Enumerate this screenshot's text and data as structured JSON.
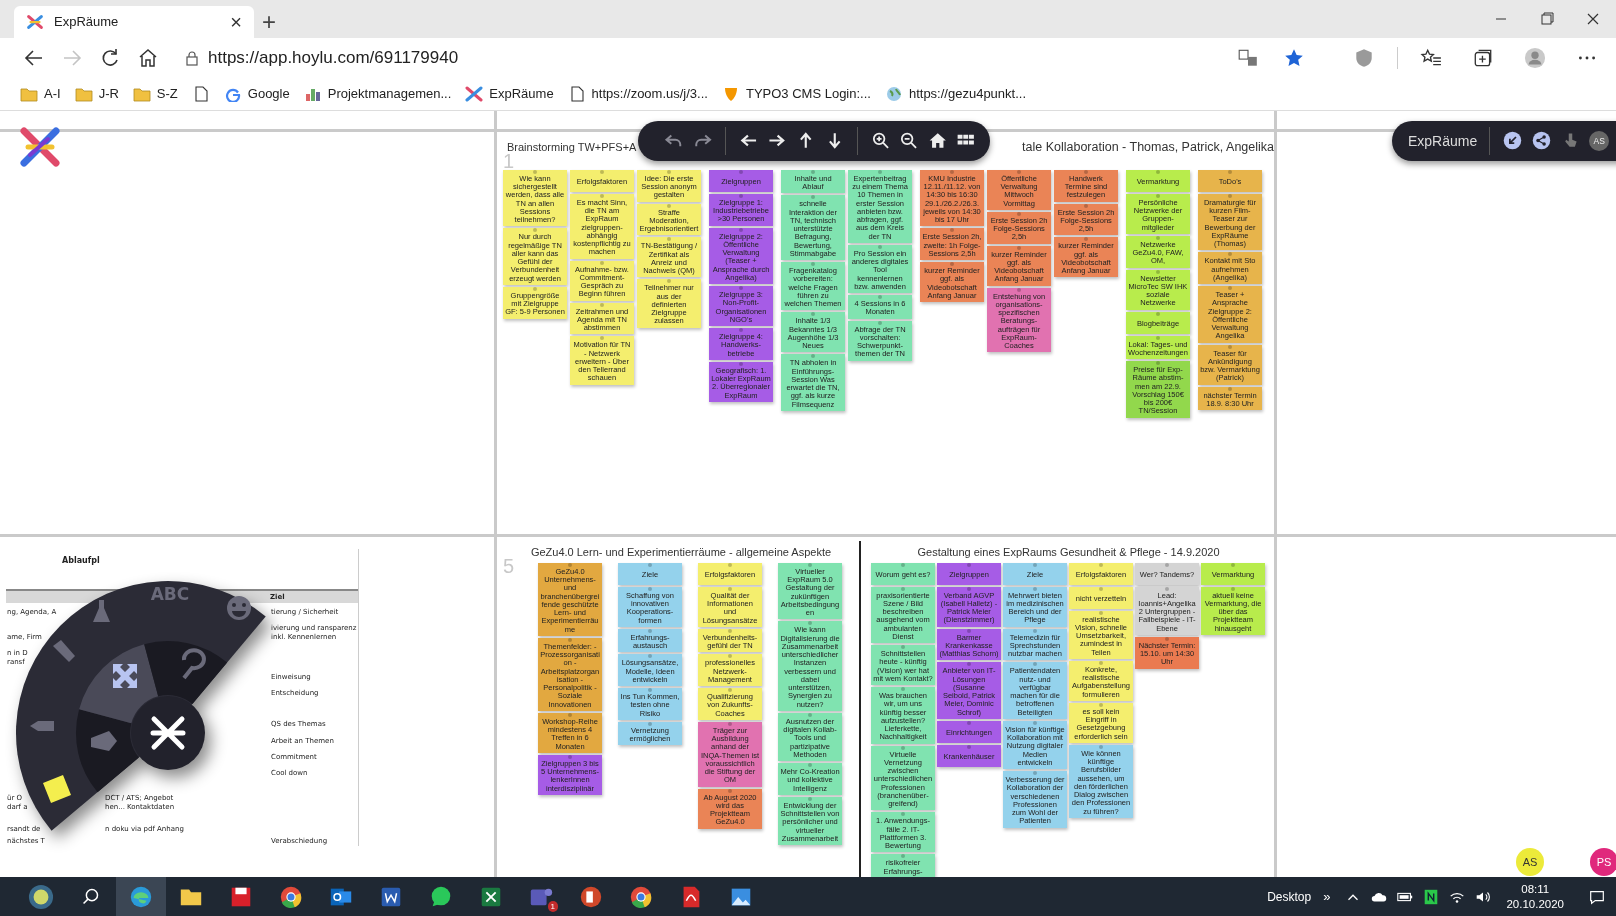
{
  "browser": {
    "tab": {
      "title": "ExpRäume",
      "close": "×"
    },
    "new_tab": "+",
    "back": {
      "disabled": false
    },
    "forward": {
      "disabled": true
    },
    "url": "https://app.hoylu.com/691179940",
    "bookmarks": [
      {
        "kind": "folder",
        "label": "A-I"
      },
      {
        "kind": "folder",
        "label": "J-R"
      },
      {
        "kind": "folder",
        "label": "S-Z"
      },
      {
        "kind": "page"
      },
      {
        "kind": "g-logo",
        "label": "Google"
      },
      {
        "kind": "chart",
        "label": "Projektmanagemen..."
      },
      {
        "kind": "x-logo",
        "label": "ExpRäume"
      },
      {
        "kind": "page",
        "label": "https://zoom.us/j/3..."
      },
      {
        "kind": "cms",
        "label": "TYPO3 CMS Login:..."
      },
      {
        "kind": "globe",
        "label": "https://gezu4punkt..."
      }
    ]
  },
  "right_toolbar": {
    "title": "ExpRäume",
    "avatar": "AS"
  },
  "panels": [
    {
      "number": "1",
      "sections": [
        {
          "title": "Brainstorming TW+PFS+A",
          "divider": false,
          "groups": [
            {
              "columns": [
                {
                  "notes": [
                    {
                      "text": "Wie kann sichergestellt werden, dass alle TN an allen Sessions teilnehmen?",
                      "color": "#f4ee6e"
                    },
                    {
                      "text": "Nur durch regelmäßige TN aller kann das Gefühl der Verbundenheit erzeugt werden",
                      "color": "#f4ee6e"
                    },
                    {
                      "text": "Gruppengröße mit Zielgruppe GF: 5-9 Personen",
                      "color": "#f4ee6e"
                    }
                  ]
                },
                {
                  "notes": [
                    {
                      "text": "Erfolgsfaktoren",
                      "color": "#f4ee6e"
                    },
                    {
                      "text": "Es macht Sinn, die TN am ExpRaum zielgruppen-abhängig kostenpflichtig zu machen",
                      "color": "#f4ee6e"
                    },
                    {
                      "text": "Aufnahme- bzw. Commitment-Gespräch zu Beginn führen",
                      "color": "#f4ee6e"
                    },
                    {
                      "text": "Zeitrahmen und Agenda mit TN abstimmen",
                      "color": "#f4ee6e"
                    },
                    {
                      "text": "Motivation für TN - Netzwerk erweitern - Über den Tellerrand schauen",
                      "color": "#f4ee6e"
                    }
                  ]
                },
                {
                  "notes": [
                    {
                      "text": "Idee: Die erste Session anonym gestalten",
                      "color": "#f4ee6e"
                    },
                    {
                      "text": "Straffe Moderation, Ergebnisorientiert",
                      "color": "#f4ee6e"
                    },
                    {
                      "text": "TN-Bestätigung / Zertifikat als Anreiz und Nachweis (QM)",
                      "color": "#f4ee6e"
                    },
                    {
                      "text": "Teilnehmer nur aus der definierten Zielgruppe zulassen",
                      "color": "#f4ee6e"
                    }
                  ]
                }
              ]
            },
            {
              "columns": [
                {
                  "notes": [
                    {
                      "text": "Zielgruppen",
                      "color": "#a65ce6"
                    },
                    {
                      "text": "Zielgruppe 1: Industriebetriebe >30 Personen",
                      "color": "#a65ce6"
                    },
                    {
                      "text": "Zielgruppe 2: Öffentliche Verwaltung (Teaser + Ansprache durch Angelika)",
                      "color": "#a65ce6"
                    },
                    {
                      "text": "Zielgruppe 3: Non-Profit-Organisationen NGO's",
                      "color": "#a65ce6"
                    },
                    {
                      "text": "Zielgruppe 4: Handwerks-betriebe",
                      "color": "#a65ce6"
                    },
                    {
                      "text": "Geografisch: 1. Lokaler ExpRaum 2. Überregionaler ExpRaum",
                      "color": "#a65ce6"
                    }
                  ]
                }
              ]
            },
            {
              "columns": [
                {
                  "notes": [
                    {
                      "text": "Inhalte und Ablauf",
                      "color": "#80e3b0"
                    },
                    {
                      "text": "schnelle Interaktion der TN, technisch unterstützte Befragung, Bewertung, Stimmabgabe",
                      "color": "#80e3b0"
                    },
                    {
                      "text": "Fragenkatalog vorbereiten: welche Fragen führen zu welchen Themen",
                      "color": "#80e3b0"
                    },
                    {
                      "text": "Inhalte 1/3 Bekanntes 1/3 Augenhöhe 1/3 Neues",
                      "color": "#80e3b0"
                    },
                    {
                      "text": "TN abholen in Einführungs-Session Was erwartet die TN, ggf. als kurze Filmsequenz",
                      "color": "#80e3b0"
                    }
                  ]
                },
                {
                  "notes": [
                    {
                      "text": "Expertenbeitrag zu einem Thema 10 Themen in erster Session anbieten bzw. abfragen, ggf. aus dem Kreis der TN",
                      "color": "#80e3b0"
                    },
                    {
                      "text": "Pro Session ein anderes digitales Tool kennenlernen bzw. anwenden",
                      "color": "#80e3b0"
                    },
                    {
                      "text": "4 Sessions in 6 Monaten",
                      "color": "#80e3b0"
                    },
                    {
                      "text": "Abfrage der TN vorschalten: Schwerpunkt-themen der TN",
                      "color": "#80e3b0"
                    }
                  ]
                }
              ]
            }
          ]
        },
        {
          "title": "tale Kollaboration - Thomas, Patrick, Angelika",
          "divider": false,
          "groups": [
            {
              "columns": [
                {
                  "notes": [
                    {
                      "text": "KMU Industrie 12.11./11.12. von 14:30 bis 16:30 29.1./26.2./26.3. jeweils von 14:30 bis 17 Uhr",
                      "color": "#ea8456"
                    },
                    {
                      "text": "Erste Session 2h, zweite: 1h Folge-Sessions 2,5h",
                      "color": "#ea8456"
                    },
                    {
                      "text": "kurzer Reminder ggf. als Videobotschaft Anfang Januar",
                      "color": "#ea8456"
                    }
                  ]
                },
                {
                  "notes": [
                    {
                      "text": "Öffentliche Verwaltung Mittwoch Vormittag",
                      "color": "#ea8456"
                    },
                    {
                      "text": "Erste Session 2h Folge-Sessions 2,5h",
                      "color": "#ea8456"
                    },
                    {
                      "text": "kurzer Reminder ggf. als Videobotschaft Anfang Januar",
                      "color": "#ea8456"
                    },
                    {
                      "text": "Entstehung von organisations-spezifischen Beratungs-aufträgen für ExpRaum-Coaches",
                      "color": "#e172b0"
                    }
                  ]
                },
                {
                  "notes": [
                    {
                      "text": "Handwerk Termine sind festzulegen",
                      "color": "#ea8456"
                    },
                    {
                      "text": "Erste Session 2h Folge-Sessions 2,5h",
                      "color": "#ea8456"
                    },
                    {
                      "text": "kurzer Reminder ggf. als Videobotschaft Anfang Januar",
                      "color": "#ea8456"
                    }
                  ]
                }
              ]
            },
            {
              "columns": [
                {
                  "notes": [
                    {
                      "text": "Vermarktung",
                      "color": "#b8ec4c"
                    },
                    {
                      "text": "Persönliche Netzwerke der Gruppen-mitglieder",
                      "color": "#b8ec4c"
                    },
                    {
                      "text": "Netzwerke GeZu4.0, FAW, OM,",
                      "color": "#b8ec4c"
                    },
                    {
                      "text": "Newsletter MicroTec SW IHK soziale Netzwerke",
                      "color": "#b8ec4c"
                    },
                    {
                      "text": "Blogbeiträge",
                      "color": "#b8ec4c"
                    },
                    {
                      "text": "Lokal: Tages- und Wochenzeitungen",
                      "color": "#b8ec4c"
                    },
                    {
                      "text": "Preise für Exp-Räume abstim-men am 22.9. Vorschlag 150€ bis 200€ TN/Session",
                      "color": "#92d84c"
                    }
                  ]
                }
              ]
            },
            {
              "columns": [
                {
                  "notes": [
                    {
                      "text": "ToDo's",
                      "color": "#e7b44b"
                    },
                    {
                      "text": "Dramaturgie für kurzen Film-Teaser zur Bewerbung der ExpRäume (Thomas)",
                      "color": "#e7b44b"
                    },
                    {
                      "text": "Kontakt mit Sto aufnehmen (Angelika)",
                      "color": "#e7b44b"
                    },
                    {
                      "text": "Teaser + Ansprache Zielgruppe 2: Öffentliche Verwaltung Angelika",
                      "color": "#e7b44b"
                    },
                    {
                      "text": "Teaser für Ankündigung bzw. Vermarktung (Patrick)",
                      "color": "#e7b44b"
                    },
                    {
                      "text": "nächster Termin 18.9. 8:30 Uhr",
                      "color": "#e7b44b"
                    }
                  ]
                }
              ]
            }
          ]
        }
      ]
    },
    {
      "number": "5",
      "sections": [
        {
          "title": "GeZu4.0 Lern- und Experimentierräume - allgemeine Aspekte",
          "divider": false,
          "groups": [
            {
              "columns": [
                {
                  "notes": [
                    {
                      "text": "GeZu4.0 Unternehmens- und branchenübergreifende geschützte Lern- und Experimentierräume",
                      "color": "#e2a840"
                    },
                    {
                      "text": "Themenfelder: - Prozessorganisation - Arbeitsplatzorganisation - Personalpolitik -Soziale Innovationen",
                      "color": "#e2a840"
                    },
                    {
                      "text": "Workshop-Reihe mindestens 4 Treffen in 6 Monaten",
                      "color": "#e2a840"
                    },
                    {
                      "text": "Zielgruppen 3 bis 5 Unternehmens-lenkerInnen interdisziplinär",
                      "color": "#a65ce6"
                    }
                  ]
                }
              ]
            },
            {
              "columns": [
                {
                  "notes": [
                    {
                      "text": "Ziele",
                      "color": "#94d2ec"
                    },
                    {
                      "text": "Schaffung von innovativen Kooperations-formen",
                      "color": "#94d2ec"
                    },
                    {
                      "text": "Erfahrungs-austausch",
                      "color": "#94d2ec"
                    },
                    {
                      "text": "Lösungsansätze, Modelle, Ideen entwickeln",
                      "color": "#94d2ec"
                    },
                    {
                      "text": "Ins Tun Kommen, testen ohne Risiko",
                      "color": "#94d2ec"
                    },
                    {
                      "text": "Vernetzung ermöglichen",
                      "color": "#94d2ec"
                    }
                  ]
                }
              ]
            },
            {
              "columns": [
                {
                  "notes": [
                    {
                      "text": "Erfolgsfaktoren",
                      "color": "#f4ee6e"
                    },
                    {
                      "text": "Qualität der Informationen und Lösungsansätze",
                      "color": "#f4ee6e"
                    },
                    {
                      "text": "Verbundenheits-gefühl der TN",
                      "color": "#f4ee6e"
                    },
                    {
                      "text": "professionelles Netzwerk-Management",
                      "color": "#f4ee6e"
                    },
                    {
                      "text": "Qualifizierung von Zukunfts-Coaches",
                      "color": "#f4ee6e"
                    },
                    {
                      "text": "Träger zur Ausbildung anhand der INQA-Themen ist voraussichtlich die Stiftung der OM",
                      "color": "#e172b0"
                    },
                    {
                      "text": "Ab August 2020 wird das Projektteam GeZu4.0",
                      "color": "#ea8456"
                    }
                  ]
                }
              ]
            },
            {
              "columns": [
                {
                  "notes": [
                    {
                      "text": "Virtueller ExpRaum 5.0 Gestaltung der zukünftigen Arbeitsbedingungen",
                      "color": "#80e3b0"
                    },
                    {
                      "text": "Wie kann Digitalisierung die Zusammenarbeit unterschiedlicher Instanzen verbessern und dabei unterstützen, Synergien zu nutzen?",
                      "color": "#80e3b0"
                    },
                    {
                      "text": "Ausnutzen der digitalen Kollab-Tools und partizipative Methoden",
                      "color": "#80e3b0"
                    },
                    {
                      "text": "Mehr Co-Kreation und kollektive Intelligenz",
                      "color": "#80e3b0"
                    },
                    {
                      "text": "Entwicklung der Schnittstellen von persönlicher und virtueller Zusammenarbeit",
                      "color": "#80e3b0"
                    }
                  ]
                }
              ]
            }
          ]
        },
        {
          "title": "Gestaltung eines ExpRaums Gesundheit & Pflege - 14.9.2020",
          "divider": true,
          "groups": [
            {
              "columns": [
                {
                  "notes": [
                    {
                      "text": "Worum geht es?",
                      "color": "#80e3b0"
                    },
                    {
                      "text": "praxisorientierte Szene / Bild beschreiben ausgehend vom ambulanten Dienst",
                      "color": "#80e3b0"
                    },
                    {
                      "text": "Schnittstellen heute - künftig (Vision) wer hat mit wem Kontakt?",
                      "color": "#80e3b0"
                    },
                    {
                      "text": "Was brauchen wir, um uns künftig besser aufzustellen? Lieferkette, Nachhaltigkeit",
                      "color": "#80e3b0"
                    },
                    {
                      "text": "Virtuelle Vernetzung zwischen unterschiedlichen Professionen (branchenüber-greifend)",
                      "color": "#80e3b0"
                    },
                    {
                      "text": "1. Anwendungs-fälle 2. IT-Plattformen 3. Bewertung",
                      "color": "#80e3b0"
                    },
                    {
                      "text": "risikofreier Erfahrungs-",
                      "color": "#80e3b0"
                    }
                  ]
                }
              ]
            },
            {
              "columns": [
                {
                  "notes": [
                    {
                      "text": "Zielgruppen",
                      "color": "#a65ce6"
                    },
                    {
                      "text": "Verband AGVP (Isabell Halletz) - Patrick Meier (Dienstzimmer)",
                      "color": "#a65ce6"
                    },
                    {
                      "text": "Barmer Krankenkasse (Matthias Schorn)",
                      "color": "#a65ce6"
                    },
                    {
                      "text": "Anbieter von IT-Lösungen (Susanne Seibold, Patrick Meier, Dominic Schrof)",
                      "color": "#a65ce6"
                    },
                    {
                      "text": "Einrichtungen",
                      "color": "#a65ce6"
                    },
                    {
                      "text": "Krankenhäuser",
                      "color": "#a65ce6"
                    }
                  ]
                }
              ]
            },
            {
              "columns": [
                {
                  "notes": [
                    {
                      "text": "Ziele",
                      "color": "#94d2ec"
                    },
                    {
                      "text": "Mehrwert bieten im medizinischen Bereich und der Pflege",
                      "color": "#94d2ec"
                    },
                    {
                      "text": "Telemedizin für Sprechstunden nutzbar machen",
                      "color": "#94d2ec"
                    },
                    {
                      "text": "Patientendaten nutz- und verfügbar machen für die betroffenen Beteiligten",
                      "color": "#94d2ec"
                    },
                    {
                      "text": "Vision für künftige Kollaboration mit Nutzung digitaler Medien entwickeln",
                      "color": "#94d2ec"
                    },
                    {
                      "text": "Verbesserung der Kollaboration der verschiedenen Professionen zum Wohl der Patienten",
                      "color": "#94d2ec"
                    }
                  ]
                }
              ]
            },
            {
              "columns": [
                {
                  "notes": [
                    {
                      "text": "Erfolgsfaktoren",
                      "color": "#f4ee6e"
                    },
                    {
                      "text": "nicht verzetteln",
                      "color": "#f4ee6e"
                    },
                    {
                      "text": "realistische Vision, schnelle Umsetzbarkeit, zumindest in Teilen",
                      "color": "#f4ee6e"
                    },
                    {
                      "text": "Konkrete, realistische Aufgabenstellung formulieren",
                      "color": "#f4ee6e"
                    },
                    {
                      "text": "es soll kein Eingriff in Gesetzgebung erforderlich sein",
                      "color": "#f4ee6e"
                    },
                    {
                      "text": "Wie können künftige Berufsbilder aussehen, um den förderlichen Dialog zwischen den Professionen zu führen?",
                      "color": "#94d2ec"
                    }
                  ]
                }
              ]
            },
            {
              "columns": [
                {
                  "notes": [
                    {
                      "text": "Wer? Tandems?",
                      "color": "#d4d4d4"
                    },
                    {
                      "text": "Lead: Ioannis+Angelika 2 Untergruppen - Fallbeispiele - IT-Ebene",
                      "color": "#d4d4d4"
                    },
                    {
                      "text": "Nächster Termin: 15.10. um 14:30 Uhr",
                      "color": "#ea7a50"
                    }
                  ]
                }
              ]
            },
            {
              "columns": [
                {
                  "notes": [
                    {
                      "text": "Vermarktung",
                      "color": "#b8ec4c"
                    },
                    {
                      "text": "aktuell keine Vermarktung, die über das Projektteam hinausgeht",
                      "color": "#b8ec4c"
                    }
                  ]
                }
              ]
            }
          ]
        }
      ]
    }
  ],
  "document": {
    "title": "Ablaufpl",
    "header": "Ziel",
    "rows": [
      {
        "left": "ng, Agenda, A",
        "right": "tierung / Sicherheit"
      },
      {
        "left": "ame, Firm",
        "right": "ivierung und ransparenz inkl. Kennenlernen"
      },
      {
        "left": "n in D"
      },
      {
        "left": "ransf"
      },
      {
        "right": "Einweisung"
      },
      {
        "right": "Entscheidung"
      },
      {
        "right": "QS des Themas"
      },
      {
        "right": "Arbeit an Themen"
      },
      {
        "right": "Commitment"
      },
      {
        "right": "Cool down"
      },
      {
        "left": "ür O",
        "middle": "DCT / ATS; Angebot"
      },
      {
        "left": "darf a",
        "middle": "hen... Kontaktdaten"
      },
      {
        "left": "rsandt de",
        "middle": "n doku via pdf Anhang"
      },
      {
        "left": "nächstes T",
        "right": "Verabschiedung"
      }
    ]
  },
  "radial_menu": {
    "text_tool": "ABC"
  },
  "avatars": [
    {
      "initials": "AS",
      "color": "#ecea3a"
    },
    {
      "initials": "PS",
      "color": "#e0287c"
    }
  ],
  "taskbar": {
    "apps": [
      {
        "kind": "start",
        "selected": false
      },
      {
        "kind": "search",
        "selected": false
      },
      {
        "kind": "browser",
        "selected": true
      },
      {
        "kind": "folder",
        "selected": false
      },
      {
        "kind": "disk",
        "selected": false
      },
      {
        "kind": "chrome",
        "selected": false
      },
      {
        "kind": "mail",
        "selected": false
      },
      {
        "kind": "word",
        "selected": false
      },
      {
        "kind": "chat",
        "selected": false
      },
      {
        "kind": "sheet",
        "selected": false
      },
      {
        "kind": "team",
        "selected": false,
        "badge": "1"
      },
      {
        "kind": "slides",
        "selected": false
      },
      {
        "kind": "chrome",
        "selected": false
      },
      {
        "kind": "pdf",
        "selected": false
      },
      {
        "kind": "photos",
        "selected": false
      }
    ],
    "desktop": "Desktop",
    "more": "»",
    "time": "08:11",
    "date": "20.10.2020"
  }
}
